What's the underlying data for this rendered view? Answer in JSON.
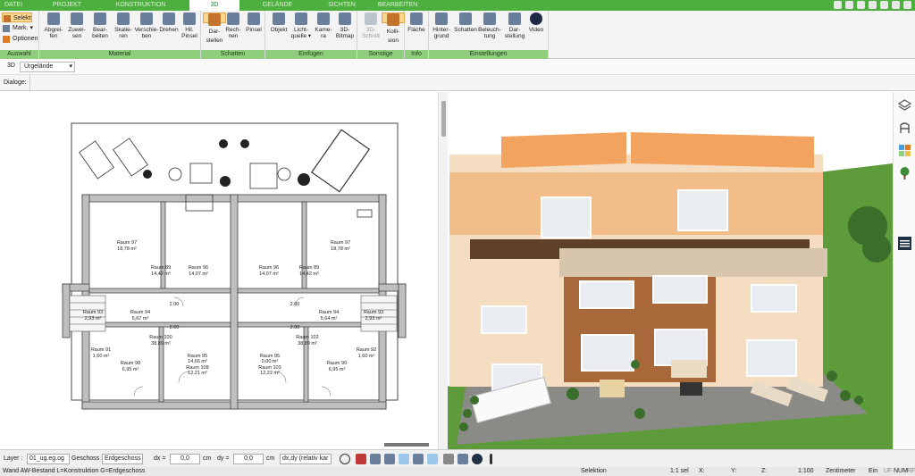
{
  "tabs": [
    "DATEI",
    "PROJEKT",
    "KONSTRUKTION",
    "3D",
    "GELÄNDE",
    "SICHTEN",
    "BEARBEITEN"
  ],
  "left_group": {
    "selekt": "Selekt",
    "mark": "Mark.",
    "optionen": "Optionen",
    "label": "Auswahl"
  },
  "material": {
    "label": "Material",
    "buttons": [
      [
        "Abgrei-",
        "fen"
      ],
      [
        "Zuwei-",
        "sen"
      ],
      [
        "Bear-",
        "beiten"
      ],
      [
        "Skalie-",
        "ren"
      ],
      [
        "Verschie-",
        "ben"
      ],
      [
        "Drehen",
        ""
      ],
      [
        "Hil.",
        "Pinsel"
      ]
    ]
  },
  "schatten": {
    "label": "Schatten",
    "buttons": [
      [
        "Dar-",
        "stellen"
      ],
      [
        "Rech-",
        "nen"
      ],
      [
        "Pinsel",
        ""
      ]
    ]
  },
  "einfuegen": {
    "label": "Einfügen",
    "buttons": [
      [
        "Objekt",
        ""
      ],
      [
        "Licht-",
        "quelle ▾"
      ],
      [
        "Kame-",
        "ra"
      ],
      [
        "3D-",
        "Bitmap"
      ]
    ]
  },
  "sonstige": {
    "label": "Sonstige",
    "buttons": [
      [
        "3D-",
        "Schnitt"
      ],
      [
        "Kolli-",
        "sion"
      ]
    ]
  },
  "info": {
    "label": "Info",
    "buttons": [
      [
        "Fläche",
        ""
      ]
    ]
  },
  "einstellungen": {
    "label": "Einstellungen",
    "buttons": [
      [
        "Hinter-",
        "grund"
      ],
      [
        "Schatten",
        ""
      ],
      [
        "Beleuch-",
        "tung"
      ],
      [
        "Dar-",
        "stellung"
      ],
      [
        "Video",
        ""
      ]
    ]
  },
  "row2": {
    "mode": "3D",
    "layer_select": "Urgelände"
  },
  "row3": {
    "label": "Dialoge:"
  },
  "rooms": [
    {
      "n": "Raum 97",
      "a": "18,78 m²"
    },
    {
      "n": "Raum 97",
      "a": "18,78 m²"
    },
    {
      "n": "Raum 96",
      "a": "14,07 m²"
    },
    {
      "n": "Raum 96",
      "a": "14,07 m²"
    },
    {
      "n": "Raum 89",
      "a": "14,42 m²"
    },
    {
      "n": "Raum 89",
      "a": "14,42 m²"
    },
    {
      "n": "Raum 94",
      "a": "5,67 m²"
    },
    {
      "n": "Raum 94",
      "a": "5,64 m²"
    },
    {
      "n": "Raum 95",
      "a": "14,66 m²"
    },
    {
      "n": "Raum 95",
      "a": "0,00 m²"
    },
    {
      "n": "Raum 108",
      "a": "12,21 m²"
    },
    {
      "n": "Raum 103",
      "a": "12,22 m²"
    },
    {
      "n": "Raum 93",
      "a": "2,93 m²"
    },
    {
      "n": "Raum 93",
      "a": "2,93 m²"
    },
    {
      "n": "Raum 100",
      "a": "38,89 m²"
    },
    {
      "n": "Raum 102",
      "a": "38,89 m²"
    },
    {
      "n": "Raum 91",
      "a": "1,60 m²"
    },
    {
      "n": "Raum 92",
      "a": "1,60 m²"
    },
    {
      "n": "Raum 90",
      "a": "6,95 m²"
    },
    {
      "n": "Raum 90",
      "a": "6,95 m²"
    }
  ],
  "plan_dims": [
    "2.00",
    "2.00",
    "2.00",
    "2.00"
  ],
  "bottom": {
    "layer_label": "Layer :",
    "layer_value": "01_ug.eg.og",
    "geschoss_label": "Geschoss :",
    "geschoss_value": "Erdgeschoss",
    "dx_label": "dx =",
    "dx_value": "0,0",
    "dx_unit": "cm",
    "dy_label": "dy =",
    "dy_value": "0,0",
    "dy_unit": "cm",
    "rel": "dx,dy (relativ kar"
  },
  "status": {
    "left": "Wand AW-Bestand L=Konstruktion G=Erdgeschoss",
    "selektion": "Selektion",
    "sel": "1:1 sel",
    "x": "X:",
    "y": "Y:",
    "z": "Z:",
    "scale": "1:100",
    "unit": "Zentimeter",
    "ein": "Ein",
    "uf": "UF",
    "num": "NUM",
    "rf": "RF"
  },
  "colors": {
    "green": "#4caf3e",
    "ribbon_group": "#8fce7c",
    "selected": "#fcd792"
  }
}
